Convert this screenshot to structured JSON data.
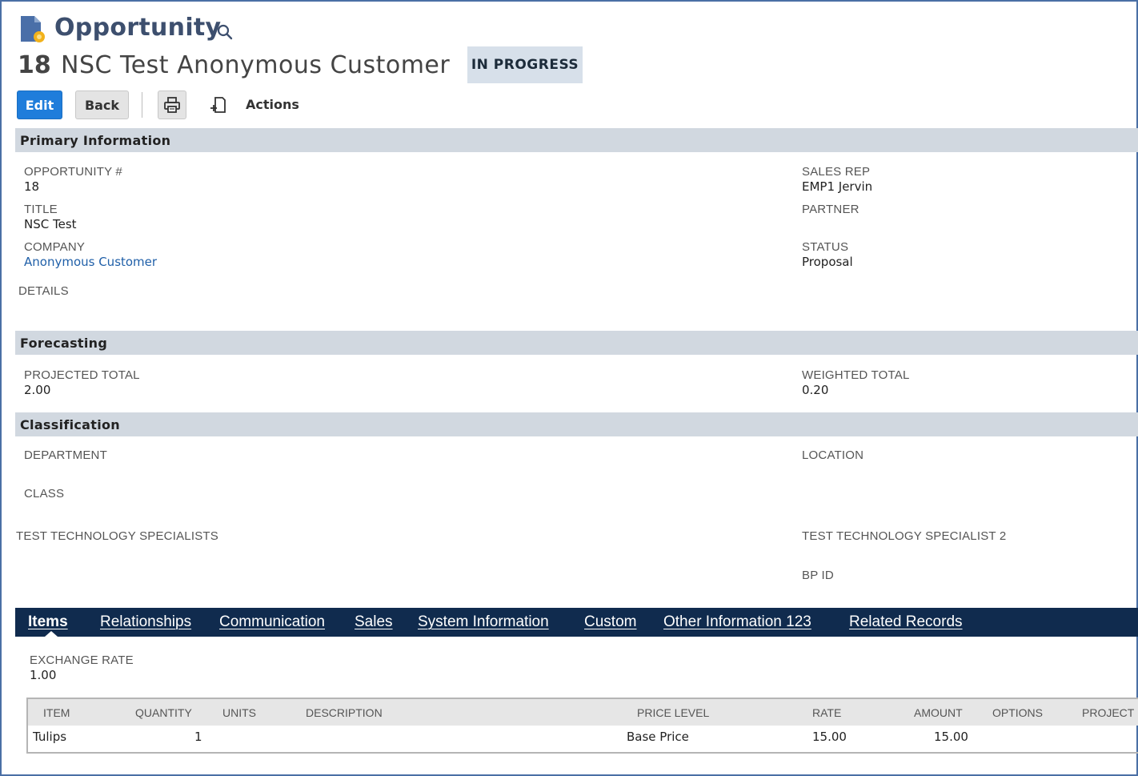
{
  "header": {
    "page_title": "Opportunity",
    "record_number": "18",
    "record_name": "NSC Test Anonymous Customer",
    "status_badge": "IN PROGRESS"
  },
  "toolbar": {
    "edit_label": "Edit",
    "back_label": "Back",
    "actions_label": "Actions"
  },
  "primary": {
    "section_title": "Primary Information",
    "opportunity_label": "OPPORTUNITY #",
    "opportunity_value": "18",
    "title_label": "TITLE",
    "title_value": "NSC Test",
    "company_label": "COMPANY",
    "company_value": "Anonymous Customer",
    "details_label": "DETAILS",
    "sales_rep_label": "SALES REP",
    "sales_rep_value": "EMP1 Jervin",
    "partner_label": "PARTNER",
    "status_label": "STATUS",
    "status_value": "Proposal"
  },
  "forecasting": {
    "section_title": "Forecasting",
    "projected_label": "PROJECTED TOTAL",
    "projected_value": "2.00",
    "weighted_label": "WEIGHTED TOTAL",
    "weighted_value": "0.20"
  },
  "classification": {
    "section_title": "Classification",
    "department_label": "DEPARTMENT",
    "class_label": "CLASS",
    "specialists_label": "TEST TECHNOLOGY SPECIALISTS",
    "location_label": "LOCATION",
    "specialist2_label": "TEST TECHNOLOGY SPECIALIST 2",
    "bpid_label": "BP ID"
  },
  "tabs": [
    {
      "label": "Items"
    },
    {
      "label": "Relationships"
    },
    {
      "label": "Communication"
    },
    {
      "label": "Sales"
    },
    {
      "label": "System Information"
    },
    {
      "label": "Custom"
    },
    {
      "label": "Other Information 123"
    },
    {
      "label": "Related Records"
    }
  ],
  "items_tab": {
    "exchange_rate_label": "EXCHANGE RATE",
    "exchange_rate_value": "1.00",
    "columns": [
      "ITEM",
      "QUANTITY",
      "UNITS",
      "DESCRIPTION",
      "PRICE LEVEL",
      "RATE",
      "AMOUNT",
      "OPTIONS",
      "PROJECT :"
    ],
    "rows": [
      {
        "item": "Tulips",
        "quantity": "1",
        "units": "",
        "description": "",
        "price_level": "Base Price",
        "rate": "15.00",
        "amount": "15.00",
        "options": "",
        "project": ""
      }
    ]
  },
  "colors": {
    "accent": "#1f7ddb",
    "tabbar": "#102b4e",
    "section_header": "#d1d8e0",
    "title": "#3d4f6e",
    "link": "#1f5fa8"
  },
  "icons": {
    "page": "opportunity-doc-icon",
    "search": "search-icon",
    "print": "print-icon",
    "actions": "actions-icon"
  }
}
